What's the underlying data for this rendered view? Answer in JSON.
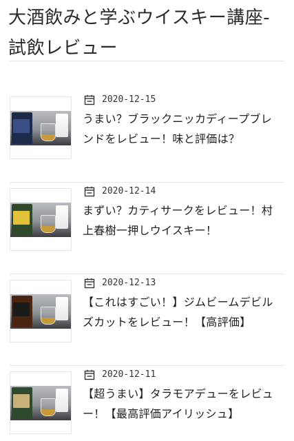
{
  "page": {
    "title": "大酒飲みと学ぶウイスキー講座-試飲レビュー"
  },
  "posts": [
    {
      "date": "2020-12-15",
      "title": "うまい？ブラックニッカディープブレンドをレビュー！味と評価は？",
      "thumb": {
        "bottle_color": "#1d2a4a",
        "label_color": "#3a4f86"
      }
    },
    {
      "date": "2020-12-14",
      "title": "まずい？カティサークをレビュー！村上春樹一押しウイスキー！",
      "thumb": {
        "bottle_color": "#2f4a2a",
        "label_color": "#e2c23a"
      }
    },
    {
      "date": "2020-12-13",
      "title": "【これはすごい！】ジムビームデビルズカットをレビュー！【高評価】",
      "thumb": {
        "bottle_color": "#4a2612",
        "label_color": "#1b1b1b"
      }
    },
    {
      "date": "2020-12-11",
      "title": "【超うまい】タラモアデューをレビュー！【最高評価アイリッシュ】",
      "thumb": {
        "bottle_color": "#2e4a2f",
        "label_color": "#c9b27a"
      }
    }
  ],
  "icons": {
    "date": "calendar-icon"
  },
  "colors": {
    "text": "#222222",
    "divider": "#e8e8e8",
    "background": "#ffffff"
  }
}
